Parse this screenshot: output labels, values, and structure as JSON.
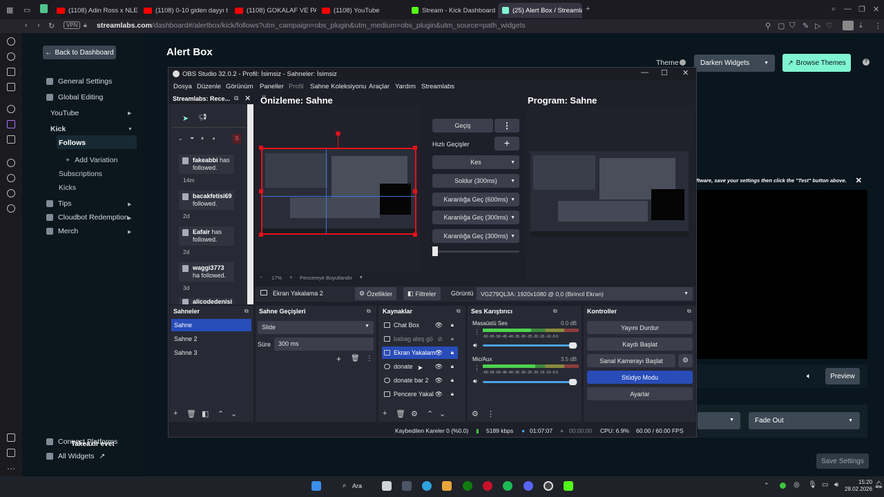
{
  "browser": {
    "tabs": [
      {
        "label": "(1108) Adin Ross x NLE Ch",
        "icon": "youtube-icon"
      },
      {
        "label": "(1108) 0-10 giden dayyı ta",
        "icon": "youtube-icon"
      },
      {
        "label": "(1108) GOKALAF VE PANK",
        "icon": "youtube-icon"
      },
      {
        "label": "(1108) YouTube",
        "icon": "youtube-icon"
      },
      {
        "label": "Stream - Kick Dashboard",
        "icon": "kick-icon"
      },
      {
        "label": "(25) Alert Box / Streamlabs",
        "icon": "streamlabs-icon"
      }
    ],
    "vpn_badge": "VPN",
    "url_host": "streamlabs.com",
    "url_path": "/dashboard#/alertbox/kick/follows?utm_campaign=obs_plugin&utm_medium=obs_plugin&utm_source=path_widgets"
  },
  "sidebar": {
    "back_label": "Back to Dashboard",
    "general_settings": "General Settings",
    "global_editing": "Global Editing",
    "youtube": "YouTube",
    "kick": "Kick",
    "follows": "Follows",
    "add_variation": "Add Variation",
    "subscriptions": "Subscriptions",
    "kicks": "Kicks",
    "tips": "Tips",
    "cloudbot": "Cloudbot Redemption",
    "merch": "Merch",
    "connect_platforms": "Connect Platforms",
    "overlay_text": "Takeaxir evet",
    "all_widgets": "All Widgets"
  },
  "page": {
    "title": "Alert Box",
    "theme_label": "Theme",
    "theme_value": "Darken Widgets",
    "browse_themes": "Browse Themes",
    "notice": "ftware, save your settings then click the \"Test\" button above.",
    "preview_label": "Preview",
    "fade_out": "Fade Out",
    "save_settings": "Save Settings"
  },
  "obs": {
    "title": "OBS Studio 32.0.2 - Profil: İsimsiz - Sahneler: İsimsiz",
    "menu": [
      "Dosya",
      "Düzenle",
      "Görünüm",
      "Paneller",
      "Profil",
      "Sahne Koleksiyonu",
      "Araçlar",
      "Yardım",
      "Streamlabs"
    ],
    "dock_title": "Streamlabs: Rece...",
    "feed": [
      {
        "name": "fakeabbi",
        "text": " has followed.",
        "time": "14m"
      },
      {
        "name": "bacakfetisi69",
        "text": " followed.",
        "time": "2d"
      },
      {
        "name": "Eafair",
        "text": " has followed.",
        "time": "2d"
      },
      {
        "name": "waggi3773",
        "text": " ha followed.",
        "time": "3d"
      },
      {
        "name": "alicodedenisi",
        "text": "",
        "time": ""
      }
    ],
    "preview_title": "Önizleme: Sahne",
    "program_title": "Program: Sahne",
    "zoom": "17%",
    "fit_label": "Pencereye Boyutlandır",
    "transition_button": "Geçiş",
    "quick_transitions": "Hızlı Geçişler",
    "transitions": [
      "Kes",
      "Soldur (300ms)",
      "Karanlığa Geç (600ms)",
      "Karanlığa Geç (300ms)",
      "Karanlığa Geç (300ms)"
    ],
    "source_selected": "Ekran Yakalama 2",
    "properties": "Özellikler",
    "filters": "Filtreler",
    "display_label": "Görüntü",
    "display_value": "VG279QL3A: 1920x1080 @ 0,0 (Birincil Ekran)",
    "scenes_title": "Sahneler",
    "scenes": [
      "Sahne",
      "Sahne 2",
      "Sahne 3"
    ],
    "scene_transitions_title": "Sahne Geçişleri",
    "scene_transition_value": "Slide",
    "duration_label": "Süre",
    "duration_value": "300 ms",
    "sources_title": "Kaynaklar",
    "sources": [
      "Chat Box",
      "babag ateş gö",
      "Ekran Yakalam",
      "donate",
      "donate bar 2",
      "Pencere Yakal"
    ],
    "mixer_title": "Ses Karıştırıcı",
    "mixer": [
      {
        "name": "Masaüstü Ses",
        "db": "0.0 dB",
        "level": 0.5
      },
      {
        "name": "Mic/Aux",
        "db": "3.5 dB",
        "level": 0.55
      }
    ],
    "meter_ticks": "-60 -55 -50 -45 -40 -35 -30 -25 -20 -15 -10 -5  0",
    "controls_title": "Kontroller",
    "controls": [
      "Yayını Durdur",
      "Kaydı Başlat",
      "Sanal Kamerayı Başlat",
      "Stüdyo Modu",
      "Ayarlar"
    ],
    "status": {
      "dropped": "Kaybedilen Kareler 0 (%0.0)",
      "bitrate": "5189 kbps",
      "live_time": "01:07:07",
      "rec_time": "00:00:00",
      "cpu": "CPU: 6.9%",
      "fps": "60.00 / 60.00 FPS"
    }
  },
  "taskbar": {
    "search": "Ara",
    "time": "15:20",
    "date": "28.02.2026"
  },
  "colors": {
    "streamlabs_accent": "#80f5d2",
    "obs_selection": "#284cb8",
    "preview_border": "#e5101a"
  }
}
